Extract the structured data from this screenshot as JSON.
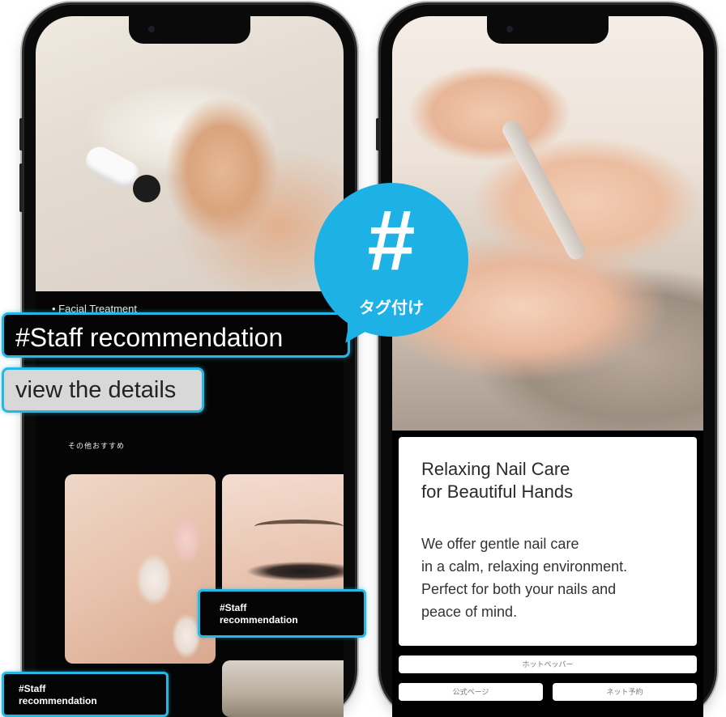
{
  "left_phone": {
    "facial_label": "• Facial Treatment",
    "staff_tag": "#Staff recommendation",
    "details_button": "view the details",
    "section_title": "その他おすすめ",
    "thumb_tag_1": "#Staff\nrecommendation",
    "thumb_tag_2": "#Staff\nrecommendation"
  },
  "bubble": {
    "symbol": "#",
    "label": "タグ付け",
    "color": "#1db1e6"
  },
  "right_phone": {
    "title": "Relaxing Nail Care\nfor Beautiful Hands",
    "body": "We offer gentle nail care\nin a calm, relaxing environment.\nPerfect for both your nails and\npeace of mind.",
    "button_wide": "ホットペッパー",
    "button_a": "公式ページ",
    "button_b": "ネット予約"
  },
  "colors": {
    "accent": "#28b7e3",
    "phone_frame": "#0a0a0a"
  }
}
